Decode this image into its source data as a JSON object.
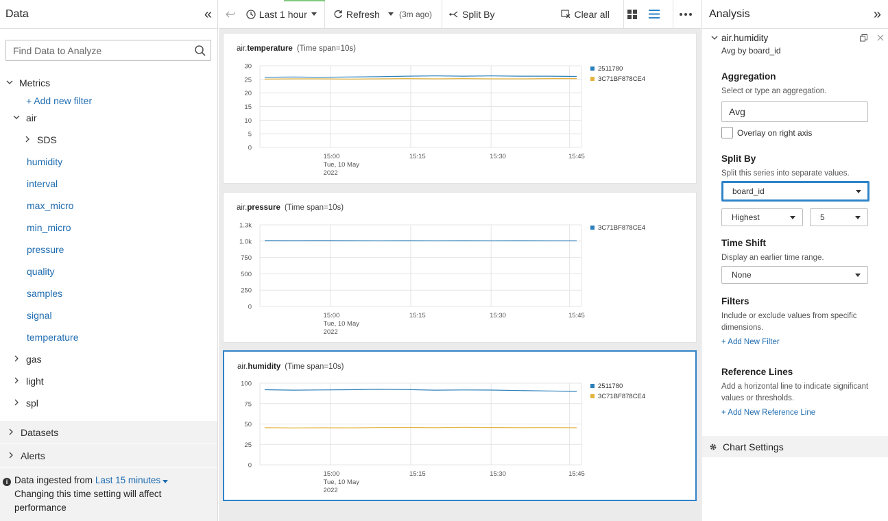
{
  "left_panel": {
    "title": "Data",
    "search_placeholder": "Find Data to Analyze",
    "metrics_label": "Metrics",
    "add_filter": "+ Add new filter",
    "air_label": "air",
    "sds_label": "SDS",
    "air_metrics": [
      "humidity",
      "interval",
      "max_micro",
      "min_micro",
      "pressure",
      "quality",
      "samples",
      "signal",
      "temperature"
    ],
    "groups": [
      "gas",
      "light",
      "spl"
    ],
    "sections": [
      "Datasets",
      "Alerts"
    ],
    "ingest": {
      "prefix": "Data ingested from",
      "range": "Last 15 minutes",
      "line2": "Changing this time setting will affect",
      "line3": "performance"
    }
  },
  "toolbar": {
    "time_range": "Last 1 hour",
    "refresh": "Refresh",
    "refresh_ago": "(3m ago)",
    "split_by": "Split By",
    "clear_all": "Clear all"
  },
  "charts": [
    {
      "prefix": "air.",
      "metric": "temperature",
      "span": "(Time span=10s)",
      "y_ticks": [
        "30",
        "25",
        "20",
        "15",
        "10",
        "5",
        "0"
      ],
      "x_ticks": [
        "15:00",
        "15:15",
        "15:30",
        "15:45"
      ],
      "x_sub": [
        "Tue, 10 May",
        "2022"
      ],
      "legend": [
        "2511780",
        "3C71BF878CE4"
      ],
      "colors": [
        "#2b7fba",
        "#e3b33d"
      ],
      "ylim": [
        0,
        30
      ],
      "series": [
        [
          25.8,
          25.9,
          25.8,
          25.9,
          26.0,
          26.2,
          26.3,
          26.2,
          26.3,
          26.2,
          26.2,
          26.1
        ],
        [
          25.1,
          25.2,
          25.2,
          25.1,
          25.2,
          25.3,
          25.2,
          25.3,
          25.2,
          25.2,
          25.3,
          25.3
        ]
      ]
    },
    {
      "prefix": "air.",
      "metric": "pressure",
      "span": "(Time span=10s)",
      "y_ticks": [
        "1.3k",
        "1.0k",
        "750",
        "500",
        "250",
        "0"
      ],
      "x_ticks": [
        "15:00",
        "15:15",
        "15:30",
        "15:45"
      ],
      "x_sub": [
        "Tue, 10 May",
        "2022"
      ],
      "legend": [
        "3C71BF878CE4"
      ],
      "colors": [
        "#2b7fba"
      ],
      "ylim": [
        0,
        1250
      ],
      "series": [
        [
          1008,
          1007,
          1008,
          1007,
          1006,
          1007,
          1006,
          1007,
          1006,
          1007,
          1006,
          1006
        ]
      ]
    },
    {
      "prefix": "air.",
      "metric": "humidity",
      "span": "(Time span=10s)",
      "y_ticks": [
        "100",
        "75",
        "50",
        "25",
        "0"
      ],
      "x_ticks": [
        "15:00",
        "15:15",
        "15:30",
        "15:45"
      ],
      "x_sub": [
        "Tue, 10 May",
        "2022"
      ],
      "legend": [
        "2511780",
        "3C71BF878CE4"
      ],
      "colors": [
        "#2b7fba",
        "#e3b33d"
      ],
      "ylim": [
        0,
        100
      ],
      "series": [
        [
          92,
          91.5,
          91.8,
          92,
          92.5,
          92.2,
          91.5,
          91.8,
          91.6,
          91,
          90.5,
          90
        ],
        [
          45.5,
          45.2,
          45.4,
          45.3,
          45.6,
          45.8,
          45.5,
          46,
          45.7,
          45.5,
          45.6,
          45.4
        ]
      ]
    }
  ],
  "analysis": {
    "title": "Analysis",
    "series_name": "air.humidity",
    "series_sub": "Avg by board_id",
    "aggregation": {
      "heading": "Aggregation",
      "desc": "Select or type an aggregation.",
      "value": "Avg",
      "overlay_label": "Overlay on right axis"
    },
    "split_by": {
      "heading": "Split By",
      "desc": "Split this series into separate values.",
      "dimension": "board_id",
      "order": "Highest",
      "limit": "5"
    },
    "time_shift": {
      "heading": "Time Shift",
      "desc": "Display an earlier time range.",
      "value": "None"
    },
    "filters": {
      "heading": "Filters",
      "desc": "Include or exclude values from specific dimensions.",
      "link": "+ Add New Filter"
    },
    "reference_lines": {
      "heading": "Reference Lines",
      "desc": "Add a horizontal line to indicate significant values or thresholds.",
      "link": "+ Add New Reference Line"
    },
    "chart_settings": "Chart Settings"
  }
}
